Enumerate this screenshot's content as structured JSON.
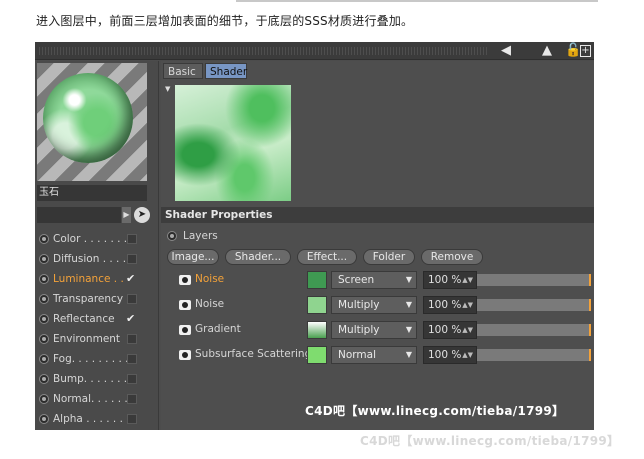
{
  "caption": "进入图层中，前面三层增加表面的细节，于底层的SSS材质进行叠加。",
  "material": {
    "name": "玉石"
  },
  "channels": [
    {
      "label": "Color . . . . . . .",
      "checked": false,
      "active": false
    },
    {
      "label": "Diffusion . . . .",
      "checked": false,
      "active": false
    },
    {
      "label": "Luminance . .",
      "checked": true,
      "active": true
    },
    {
      "label": "Transparency",
      "checked": false,
      "active": false
    },
    {
      "label": "Reflectance",
      "checked": true,
      "active": false
    },
    {
      "label": "Environment",
      "checked": false,
      "active": false
    },
    {
      "label": "Fog. . . . . . . . .",
      "checked": false,
      "active": false
    },
    {
      "label": "Bump. . . . . . . .",
      "checked": false,
      "active": false
    },
    {
      "label": "Normal. . . . . .",
      "checked": false,
      "active": false
    },
    {
      "label": "Alpha . . . . . . .",
      "checked": false,
      "active": false
    }
  ],
  "tabs": {
    "basic": "Basic",
    "shader": "Shader"
  },
  "shader_properties": {
    "heading": "Shader Properties",
    "layers_label": "Layers",
    "buttons": [
      "Image...",
      "Shader...",
      "Effect...",
      "Folder",
      "Remove"
    ]
  },
  "layers": [
    {
      "name": "Noise",
      "active": true,
      "mode": "Screen",
      "opacity": "100 %",
      "thumb_color": "#3f9a52"
    },
    {
      "name": "Noise",
      "active": false,
      "mode": "Multiply",
      "opacity": "100 %",
      "thumb_color": "#8fd48f"
    },
    {
      "name": "Gradient",
      "active": false,
      "mode": "Multiply",
      "opacity": "100 %",
      "thumb_color": "#4aa04f"
    },
    {
      "name": "Subsurface Scattering",
      "active": false,
      "mode": "Normal",
      "opacity": "100 %",
      "thumb_color": "#7fdc6f"
    }
  ],
  "watermark": "C4D吧【www.linecg.com/tieba/1799】",
  "footer_watermark": "C4D吧【www.linecg.com/tieba/1799】",
  "icons": {
    "arrow": "arrow-left-icon",
    "pointer": "pointer-up-icon",
    "lock": "lock-icon",
    "expand": "expand-icon"
  }
}
